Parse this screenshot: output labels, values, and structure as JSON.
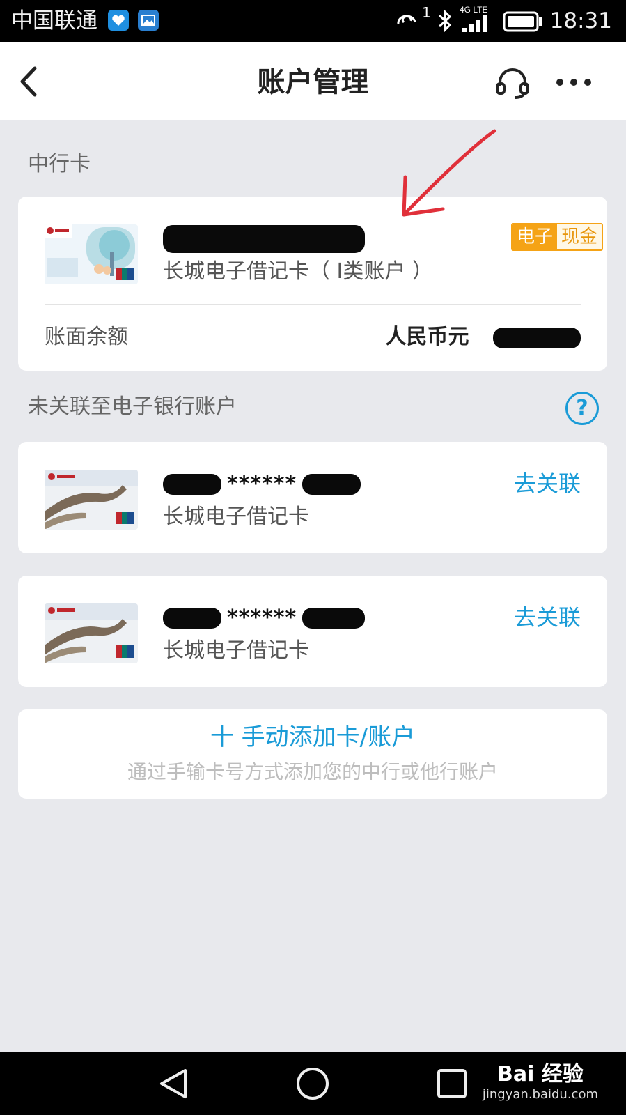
{
  "status_bar": {
    "carrier": "中国联通",
    "time": "18:31",
    "icons": [
      "health-app-icon",
      "gallery-app-icon",
      "hd-call-icon",
      "bluetooth-icon",
      "4g-lte-signal-icon",
      "battery-icon"
    ],
    "signal_sup": "1",
    "network_label": "4G LTE"
  },
  "nav": {
    "title": "账户管理",
    "back_icon": "chevron-left-icon",
    "service_icon": "headset-icon",
    "more_icon": "more-dots-icon"
  },
  "sections": {
    "boc_label": "中行卡",
    "unlinked_label": "未关联至电子银行账户",
    "help_glyph": "?"
  },
  "primary_card": {
    "type_label": "长城电子借记卡（ I类账户 ）",
    "badge_left": "电子",
    "badge_right": "现金",
    "balance_label": "账面余额",
    "currency": "人民币元"
  },
  "unlinked_cards": [
    {
      "masked": "******",
      "type_label": "长城电子借记卡",
      "action": "去关联"
    },
    {
      "masked": "******",
      "type_label": "长城电子借记卡",
      "action": "去关联"
    }
  ],
  "add_account": {
    "title": "十 手动添加卡/账户",
    "subtitle": "通过手输卡号方式添加您的中行或他行账户"
  },
  "watermark": {
    "brand": "Bai 经验",
    "url": "jingyan.baidu.com"
  },
  "colors": {
    "accent": "#1a9bd7",
    "badge_orange": "#f5a316",
    "background": "#e8e9ed",
    "annotation_red": "#e0303a"
  }
}
